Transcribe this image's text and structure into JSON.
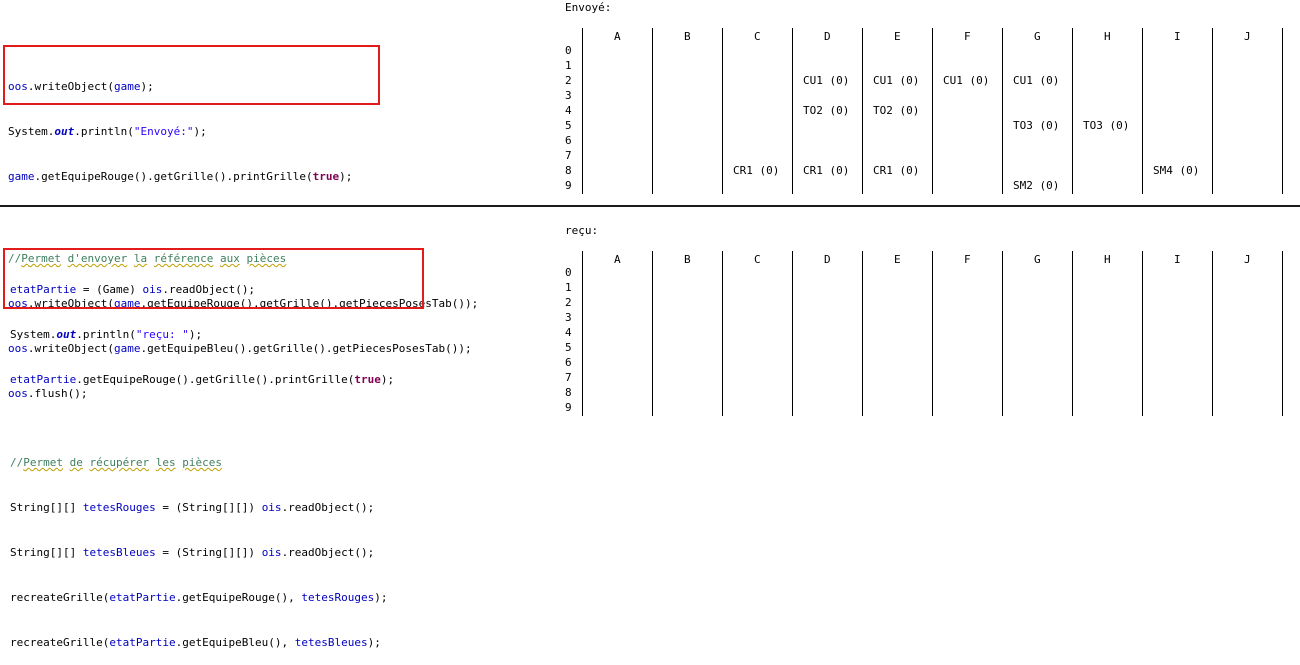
{
  "top": {
    "boxed_lines": [
      "oos.writeObject(game);",
      "System.out.println(\"Envoyé:\");",
      "game.getEquipeRouge().getGrille().printGrille(true);"
    ],
    "comment": "//Permet d'envoyer la référence aux pièces",
    "lines": [
      "oos.writeObject(game.getEquipeRouge().getGrille().getPiecesPosesTab());",
      "oos.writeObject(game.getEquipeBleu().getGrille().getPiecesPosesTab());",
      "oos.flush();"
    ],
    "grid_label": "Envoyé:"
  },
  "bottom": {
    "boxed_lines": [
      "etatPartie = (Game) ois.readObject();",
      "System.out.println(\"reçu: \");",
      "etatPartie.getEquipeRouge().getGrille().printGrille(true);"
    ],
    "comment": "//Permet de récupérer les pièces",
    "lines": [
      "String[][] tetesRouges = (String[][]) ois.readObject();",
      "String[][] tetesBleues = (String[][]) ois.readObject();",
      "recreateGrille(etatPartie.getEquipeRouge(), tetesRouges);",
      "recreateGrille(etatPartie.getEquipeBleu(), tetesBleues);"
    ],
    "grid_label": "reçu:"
  },
  "grid": {
    "columns": [
      "A",
      "B",
      "C",
      "D",
      "E",
      "F",
      "G",
      "H",
      "I",
      "J"
    ],
    "rows": [
      "0",
      "1",
      "2",
      "3",
      "4",
      "5",
      "6",
      "7",
      "8",
      "9"
    ],
    "sent_cells": [
      {
        "row": 2,
        "col": 3,
        "text": "CU1 (0)"
      },
      {
        "row": 2,
        "col": 4,
        "text": "CU1 (0)"
      },
      {
        "row": 2,
        "col": 5,
        "text": "CU1 (0)"
      },
      {
        "row": 2,
        "col": 6,
        "text": "CU1 (0)"
      },
      {
        "row": 4,
        "col": 3,
        "text": "TO2 (0)"
      },
      {
        "row": 4,
        "col": 4,
        "text": "TO2 (0)"
      },
      {
        "row": 5,
        "col": 6,
        "text": "TO3 (0)"
      },
      {
        "row": 5,
        "col": 7,
        "text": "TO3 (0)"
      },
      {
        "row": 8,
        "col": 2,
        "text": "CR1 (0)"
      },
      {
        "row": 8,
        "col": 3,
        "text": "CR1 (0)"
      },
      {
        "row": 8,
        "col": 4,
        "text": "CR1 (0)"
      },
      {
        "row": 8,
        "col": 8,
        "text": "SM4 (0)"
      },
      {
        "row": 9,
        "col": 6,
        "text": "SM2 (0)"
      }
    ],
    "received_cells": []
  }
}
